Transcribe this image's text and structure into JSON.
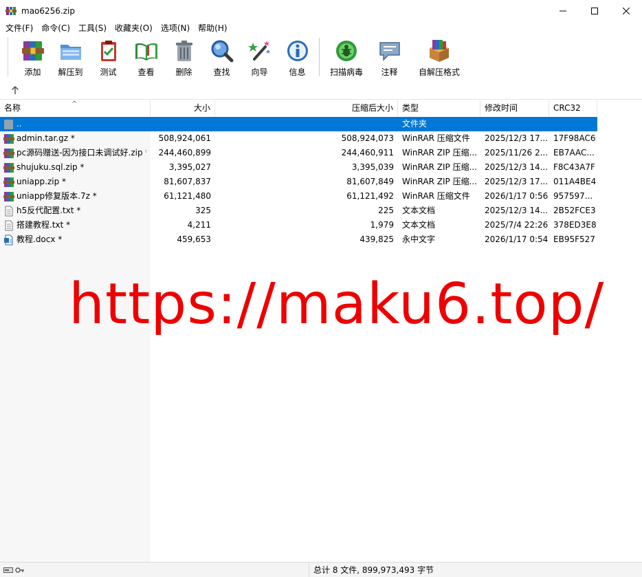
{
  "window": {
    "title": "mao6256.zip"
  },
  "menu": [
    {
      "label": "文件(F)"
    },
    {
      "label": "命令(C)"
    },
    {
      "label": "工具(S)"
    },
    {
      "label": "收藏夹(O)"
    },
    {
      "label": "选项(N)"
    },
    {
      "label": "帮助(H)"
    }
  ],
  "toolbar": {
    "add": "添加",
    "extract": "解压到",
    "test": "测试",
    "view": "查看",
    "delete": "删除",
    "find": "查找",
    "wizard": "向导",
    "info": "信息",
    "virus_scan": "扫描病毒",
    "comment": "注释",
    "sfx": "自解压格式"
  },
  "columns": {
    "name": "名称",
    "size": "大小",
    "packed": "压缩后大小",
    "type": "类型",
    "modified": "修改时间",
    "crc": "CRC32"
  },
  "rows": [
    {
      "name": "..",
      "size": "",
      "packed": "",
      "type": "文件夹",
      "modified": "",
      "crc": "",
      "icon": "folder-up-icon"
    },
    {
      "name": "admin.tar.gz *",
      "size": "508,924,061",
      "packed": "508,924,073",
      "type": "WinRAR 压缩文件",
      "modified": "2025/12/3 17...",
      "crc": "17F98AC6",
      "icon": "rar-archive-icon"
    },
    {
      "name": "pc源码赠送-因为接口未调试好.zip *",
      "size": "244,460,899",
      "packed": "244,460,911",
      "type": "WinRAR ZIP 压缩...",
      "modified": "2025/11/26 2...",
      "crc": "EB7AAC...",
      "icon": "rar-archive-icon"
    },
    {
      "name": "shujuku.sql.zip *",
      "size": "3,395,027",
      "packed": "3,395,039",
      "type": "WinRAR ZIP 压缩...",
      "modified": "2025/12/3 14...",
      "crc": "F8C43A7F",
      "icon": "rar-archive-icon"
    },
    {
      "name": "uniapp.zip *",
      "size": "81,607,837",
      "packed": "81,607,849",
      "type": "WinRAR ZIP 压缩...",
      "modified": "2025/12/3 17...",
      "crc": "011A4BE4",
      "icon": "rar-archive-icon"
    },
    {
      "name": "uniapp修复版本.7z *",
      "size": "61,121,480",
      "packed": "61,121,492",
      "type": "WinRAR 压缩文件",
      "modified": "2026/1/17 0:56",
      "crc": "957597...",
      "icon": "rar-archive-icon"
    },
    {
      "name": "h5反代配置.txt *",
      "size": "325",
      "packed": "225",
      "type": "文本文档",
      "modified": "2025/12/3 14...",
      "crc": "2B52FCE3",
      "icon": "text-file-icon"
    },
    {
      "name": "搭建教程.txt *",
      "size": "4,211",
      "packed": "1,979",
      "type": "文本文档",
      "modified": "2025/7/4 22:26",
      "crc": "378ED3E8",
      "icon": "text-file-icon"
    },
    {
      "name": "教程.docx *",
      "size": "459,653",
      "packed": "439,825",
      "type": "永中文字",
      "modified": "2026/1/17 0:54",
      "crc": "EB95F527",
      "icon": "docx-file-icon"
    }
  ],
  "watermark": "https://maku6.top/",
  "status": {
    "summary": "总计 8 文件, 899,973,493 字节"
  },
  "colors": {
    "selection": "#0078d7",
    "watermark": "#ee0000"
  }
}
